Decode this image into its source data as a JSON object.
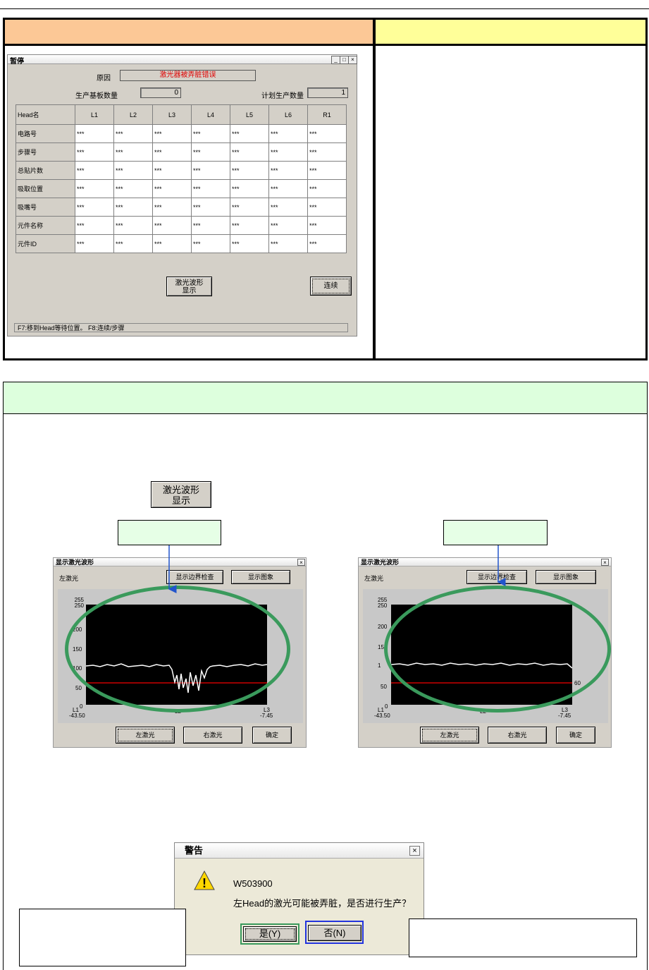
{
  "pause_window": {
    "title": "暂停",
    "reason_label": "原因",
    "reason_value": "激光器被弄脏错误",
    "produced_label": "生产基板数量",
    "produced_value": "0",
    "planned_label": "计划生产数量",
    "planned_value": "1",
    "table_corner": "Head名",
    "columns": [
      "L1",
      "L2",
      "L3",
      "L4",
      "L5",
      "L6",
      "R1"
    ],
    "rows": [
      "电路号",
      "步骤号",
      "总贴片数",
      "吸取位置",
      "吸嘴号",
      "元件名称",
      "元件ID"
    ],
    "cell_value": "***",
    "laser_button_line1": "激光波形",
    "laser_button_line2": "显示",
    "continue_button": "连续",
    "status": "F7:移到Head等待位置。  F8:连续/步骤"
  },
  "laser_button_large": {
    "line1": "激光波形",
    "line2": "显示"
  },
  "wave_left": {
    "title": "显示激光波形",
    "side_label": "左激光",
    "btn_boundary": "显示边界检查",
    "btn_image": "显示图象",
    "yticks": [
      "255",
      "250",
      "200",
      "150",
      "100",
      "50",
      "0"
    ],
    "x_left_label": "L1",
    "x_left_value": "-43.50",
    "x_mid_label": "L2",
    "x_right_label": "L3",
    "x_right_value": "-7.45",
    "btn_left": "左激光",
    "btn_right": "右激光",
    "btn_ok": "确定"
  },
  "wave_right": {
    "title": "显示激光波形",
    "side_label": "左激光",
    "btn_boundary": "显示边界检查",
    "btn_image": "显示图象",
    "yticks": [
      "255",
      "250",
      "200",
      "15",
      "1",
      "50",
      "0"
    ],
    "right_marker": "60",
    "x_left_label": "L1",
    "x_left_value": "-43.50",
    "x_mid_label": "L2",
    "x_right_label": "L3",
    "x_right_value": "-7.45",
    "btn_left": "左激光",
    "btn_right": "右激光",
    "btn_ok": "确定"
  },
  "alert": {
    "title": "警告",
    "code": "W503900",
    "message": "左Head的激光可能被弄脏，是否进行生产？",
    "yes_button": "是(Y)",
    "no_button": "否(N)"
  },
  "colors": {
    "header_left": "#fcc896",
    "header_right": "#ffff99",
    "section_header": "#ddffdd",
    "ellipse": "#3a9a5c",
    "reason_text": "#e00000",
    "threshold_line": "#cc0000"
  }
}
